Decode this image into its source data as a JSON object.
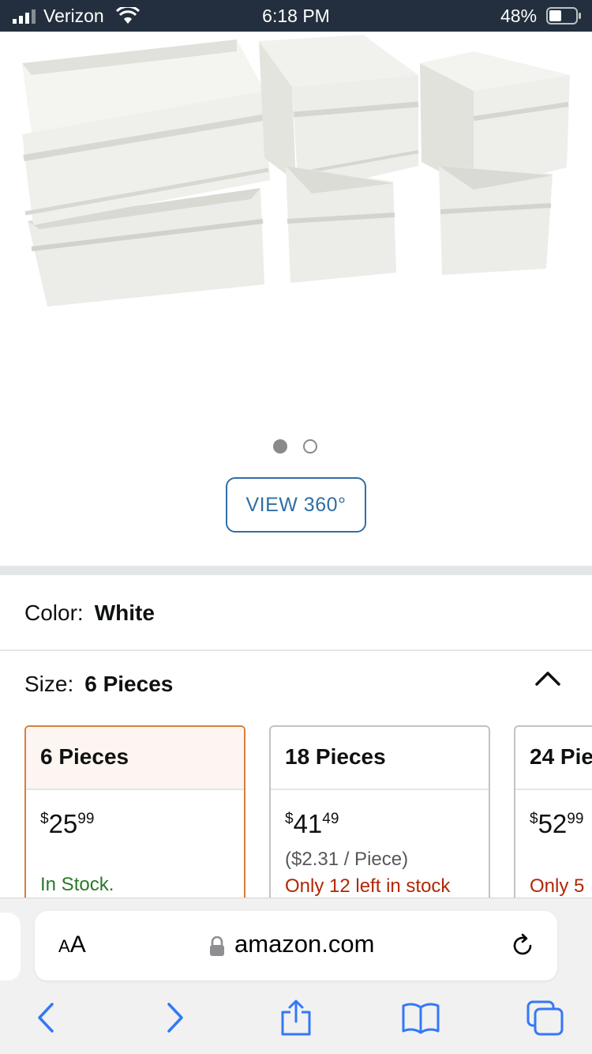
{
  "status_bar": {
    "carrier": "Verizon",
    "time": "6:18 PM",
    "battery": "48%",
    "battery_level": 0.48
  },
  "gallery": {
    "image_icon": "fabric-storage-boxes-image",
    "page_count": 2,
    "current_page": 1,
    "view360_label": "VIEW 360°"
  },
  "variations": {
    "color_label": "Color:",
    "color_value": "White",
    "size_label": "Size:",
    "size_value": "6 Pieces",
    "options": [
      {
        "name": "6 Pieces",
        "price_symbol": "$",
        "price_whole": "25",
        "price_fraction": "99",
        "per_piece": "",
        "stock": "In Stock.",
        "selected": true
      },
      {
        "name": "18 Pieces",
        "price_symbol": "$",
        "price_whole": "41",
        "price_fraction": "49",
        "per_piece": "($2.31 / Piece)",
        "stock": "Only 12 left in stock",
        "selected": false
      },
      {
        "name": "24 Pie",
        "price_symbol": "$",
        "price_whole": "52",
        "price_fraction": "99",
        "per_piece": "",
        "stock": "Only 5",
        "selected": false
      }
    ]
  },
  "browser": {
    "text_size_label_small": "A",
    "text_size_label_large": "A",
    "url": "amazon.com"
  },
  "colors": {
    "status_bar_bg": "#232f3e",
    "link_blue": "#2f6ea6",
    "selected_border": "#d67f3a",
    "in_stock_green": "#2a7a2a",
    "low_stock_red": "#b12704",
    "safari_blue": "#3478f6"
  }
}
